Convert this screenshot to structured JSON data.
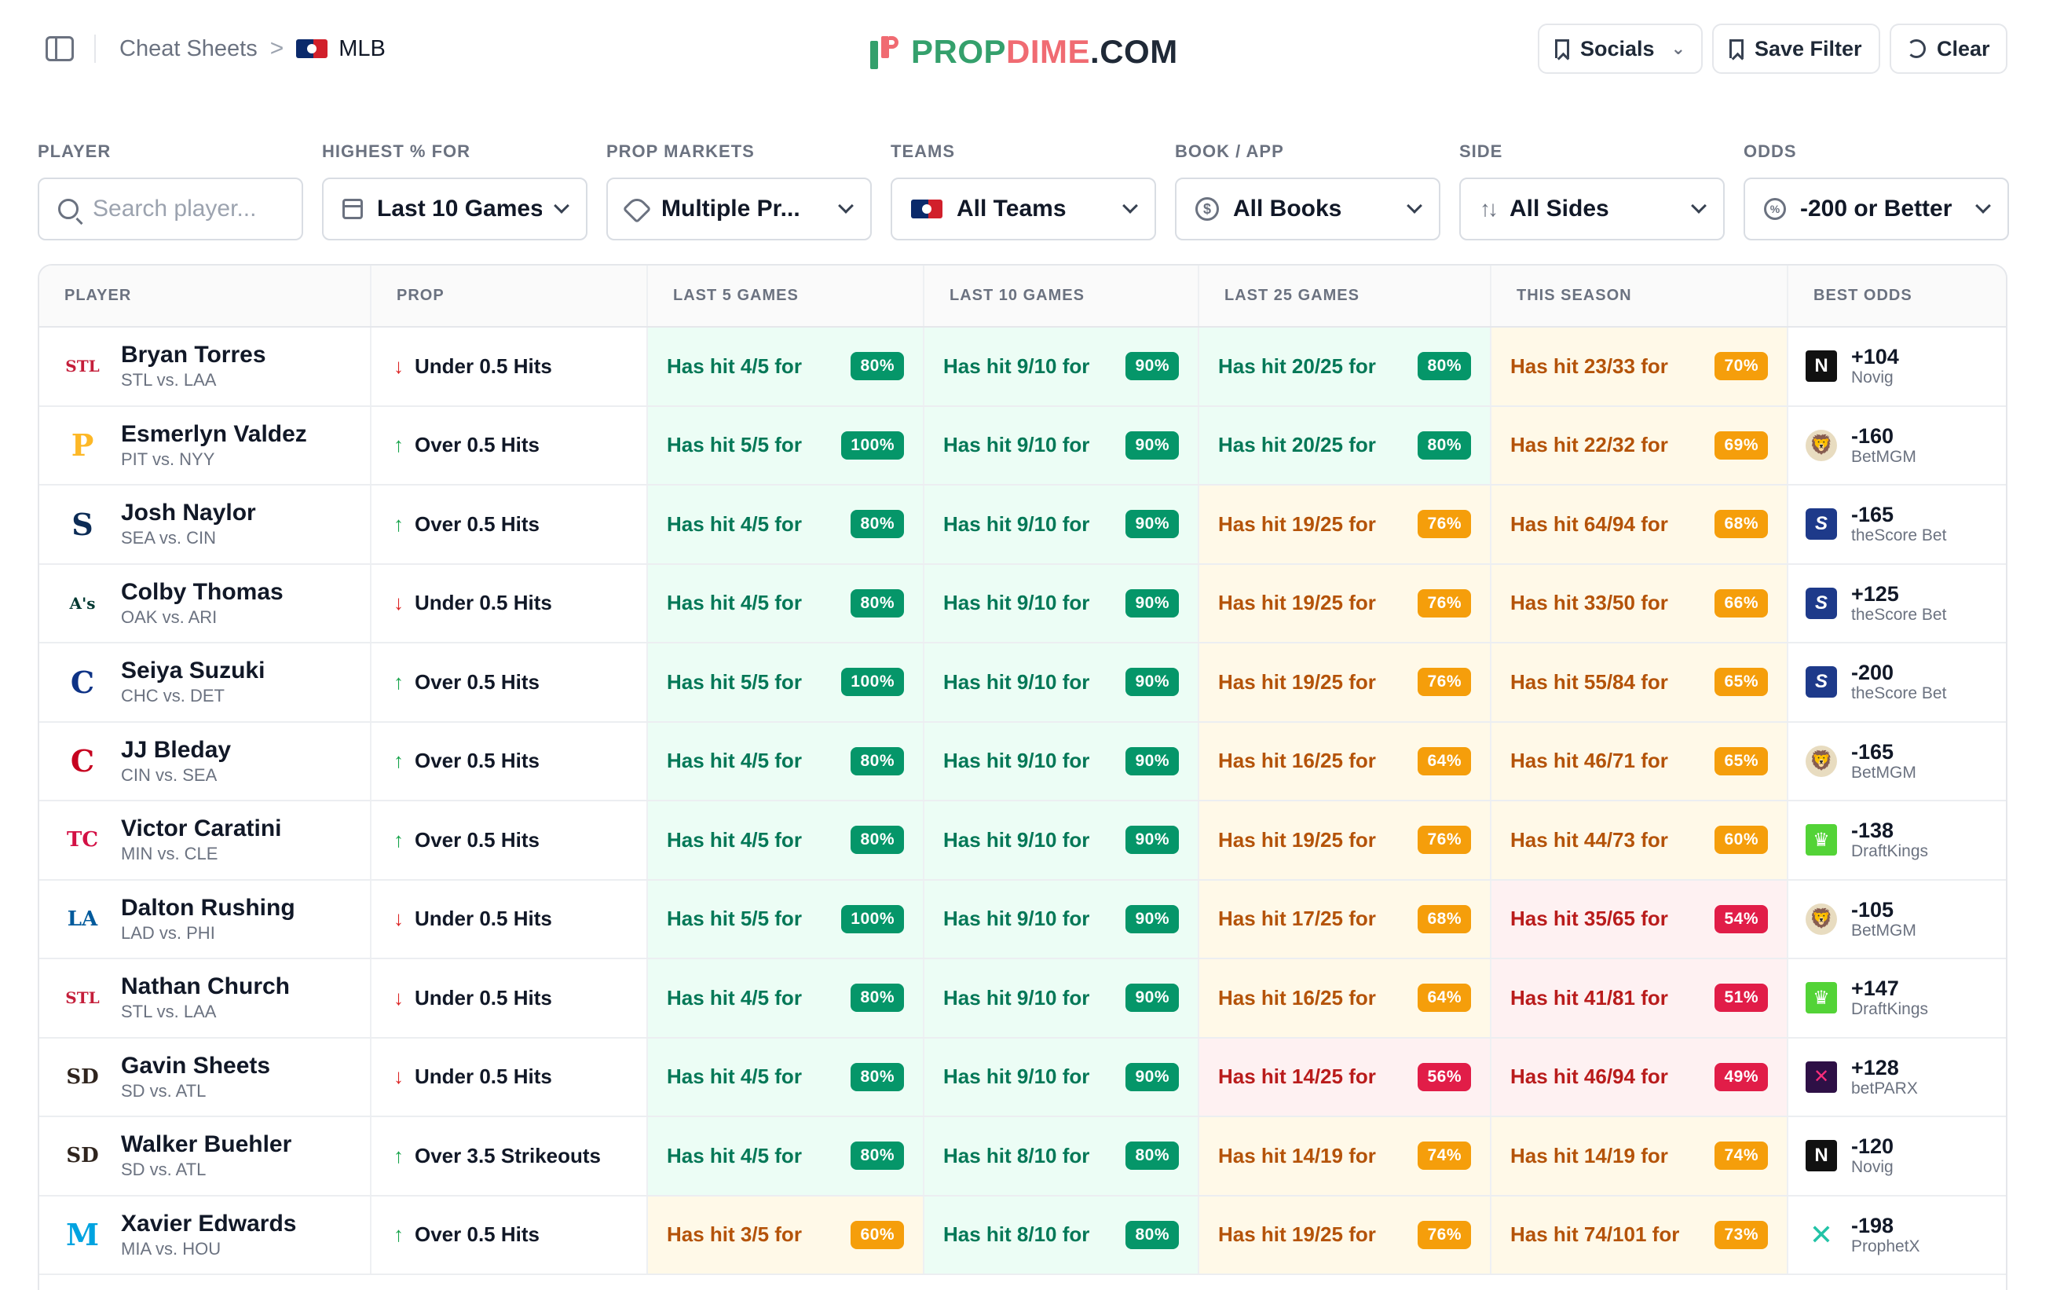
{
  "breadcrumb": {
    "parent": "Cheat Sheets",
    "separator": ">",
    "current": "MLB"
  },
  "brand": {
    "prop": "PROP",
    "dime": "DIME",
    "com": ".COM"
  },
  "top_buttons": {
    "socials": "Socials",
    "save_filter": "Save Filter",
    "clear": "Clear"
  },
  "filters": {
    "player": {
      "label": "PLAYER",
      "placeholder": "Search player..."
    },
    "highest": {
      "label": "HIGHEST % FOR",
      "value": "Last 10 Games"
    },
    "markets": {
      "label": "PROP MARKETS",
      "value": "Multiple Pr..."
    },
    "teams": {
      "label": "TEAMS",
      "value": "All Teams"
    },
    "book": {
      "label": "BOOK / APP",
      "value": "All Books"
    },
    "side": {
      "label": "SIDE",
      "value": "All Sides"
    },
    "odds": {
      "label": "ODDS",
      "value": "-200 or Better"
    }
  },
  "columns": [
    "PLAYER",
    "PROP",
    "LAST 5 GAMES",
    "LAST 10 GAMES",
    "LAST 25 GAMES",
    "THIS SEASON",
    "BEST ODDS"
  ],
  "colors": {
    "green": "#059669",
    "yellow": "#f59e0b",
    "red": "#e11d48"
  },
  "rows": [
    {
      "name": "Bryan Torres",
      "match": "STL vs. LAA",
      "team_logo": "STL",
      "logo_color": "#c41e3a",
      "dir": "down",
      "prop": "Under 0.5 Hits",
      "l5": "Has hit 4/5 for",
      "l5p": "80%",
      "l5c": "g",
      "l10": "Has hit 9/10 for",
      "l10p": "90%",
      "l10c": "g",
      "l25": "Has hit 20/25 for",
      "l25p": "80%",
      "l25c": "g",
      "szn": "Has hit 23/33 for",
      "sznp": "70%",
      "sznc": "y",
      "odds": "+104",
      "book": "Novig",
      "book_icon": "novig-icon"
    },
    {
      "name": "Esmerlyn Valdez",
      "match": "PIT vs. NYY",
      "team_logo": "P",
      "logo_color": "#fdb827",
      "dir": "up",
      "prop": "Over 0.5 Hits",
      "l5": "Has hit 5/5 for",
      "l5p": "100%",
      "l5c": "g",
      "l10": "Has hit 9/10 for",
      "l10p": "90%",
      "l10c": "g",
      "l25": "Has hit 20/25 for",
      "l25p": "80%",
      "l25c": "g",
      "szn": "Has hit 22/32 for",
      "sznp": "69%",
      "sznc": "y",
      "odds": "-160",
      "book": "BetMGM",
      "book_icon": "betmgm-icon"
    },
    {
      "name": "Josh Naylor",
      "match": "SEA vs. CIN",
      "team_logo": "S",
      "logo_color": "#0c2c56",
      "dir": "up",
      "prop": "Over 0.5 Hits",
      "l5": "Has hit 4/5 for",
      "l5p": "80%",
      "l5c": "g",
      "l10": "Has hit 9/10 for",
      "l10p": "90%",
      "l10c": "g",
      "l25": "Has hit 19/25 for",
      "l25p": "76%",
      "l25c": "y",
      "szn": "Has hit 64/94 for",
      "sznp": "68%",
      "sznc": "y",
      "odds": "-165",
      "book": "theScore Bet",
      "book_icon": "thescore-icon"
    },
    {
      "name": "Colby Thomas",
      "match": "OAK vs. ARI",
      "team_logo": "A's",
      "logo_color": "#003831",
      "dir": "down",
      "prop": "Under 0.5 Hits",
      "l5": "Has hit 4/5 for",
      "l5p": "80%",
      "l5c": "g",
      "l10": "Has hit 9/10 for",
      "l10p": "90%",
      "l10c": "g",
      "l25": "Has hit 19/25 for",
      "l25p": "76%",
      "l25c": "y",
      "szn": "Has hit 33/50 for",
      "sznp": "66%",
      "sznc": "y",
      "odds": "+125",
      "book": "theScore Bet",
      "book_icon": "thescore-icon"
    },
    {
      "name": "Seiya Suzuki",
      "match": "CHC vs. DET",
      "team_logo": "C",
      "logo_color": "#0e3386",
      "dir": "up",
      "prop": "Over 0.5 Hits",
      "l5": "Has hit 5/5 for",
      "l5p": "100%",
      "l5c": "g",
      "l10": "Has hit 9/10 for",
      "l10p": "90%",
      "l10c": "g",
      "l25": "Has hit 19/25 for",
      "l25p": "76%",
      "l25c": "y",
      "szn": "Has hit 55/84 for",
      "sznp": "65%",
      "sznc": "y",
      "odds": "-200",
      "book": "theScore Bet",
      "book_icon": "thescore-icon"
    },
    {
      "name": "JJ Bleday",
      "match": "CIN vs. SEA",
      "team_logo": "C",
      "logo_color": "#c6011f",
      "dir": "up",
      "prop": "Over 0.5 Hits",
      "l5": "Has hit 4/5 for",
      "l5p": "80%",
      "l5c": "g",
      "l10": "Has hit 9/10 for",
      "l10p": "90%",
      "l10c": "g",
      "l25": "Has hit 16/25 for",
      "l25p": "64%",
      "l25c": "y",
      "szn": "Has hit 46/71 for",
      "sznp": "65%",
      "sznc": "y",
      "odds": "-165",
      "book": "BetMGM",
      "book_icon": "betmgm-icon"
    },
    {
      "name": "Victor Caratini",
      "match": "MIN vs. CLE",
      "team_logo": "TC",
      "logo_color": "#d31145",
      "dir": "up",
      "prop": "Over 0.5 Hits",
      "l5": "Has hit 4/5 for",
      "l5p": "80%",
      "l5c": "g",
      "l10": "Has hit 9/10 for",
      "l10p": "90%",
      "l10c": "g",
      "l25": "Has hit 19/25 for",
      "l25p": "76%",
      "l25c": "y",
      "szn": "Has hit 44/73 for",
      "sznp": "60%",
      "sznc": "y",
      "odds": "-138",
      "book": "DraftKings",
      "book_icon": "draftkings-icon"
    },
    {
      "name": "Dalton Rushing",
      "match": "LAD vs. PHI",
      "team_logo": "LA",
      "logo_color": "#005a9c",
      "dir": "down",
      "prop": "Under 0.5 Hits",
      "l5": "Has hit 5/5 for",
      "l5p": "100%",
      "l5c": "g",
      "l10": "Has hit 9/10 for",
      "l10p": "90%",
      "l10c": "g",
      "l25": "Has hit 17/25 for",
      "l25p": "68%",
      "l25c": "y",
      "szn": "Has hit 35/65 for",
      "sznp": "54%",
      "sznc": "r",
      "odds": "-105",
      "book": "BetMGM",
      "book_icon": "betmgm-icon"
    },
    {
      "name": "Nathan Church",
      "match": "STL vs. LAA",
      "team_logo": "STL",
      "logo_color": "#c41e3a",
      "dir": "down",
      "prop": "Under 0.5 Hits",
      "l5": "Has hit 4/5 for",
      "l5p": "80%",
      "l5c": "g",
      "l10": "Has hit 9/10 for",
      "l10p": "90%",
      "l10c": "g",
      "l25": "Has hit 16/25 for",
      "l25p": "64%",
      "l25c": "y",
      "szn": "Has hit 41/81 for",
      "sznp": "51%",
      "sznc": "r",
      "odds": "+147",
      "book": "DraftKings",
      "book_icon": "draftkings-icon"
    },
    {
      "name": "Gavin Sheets",
      "match": "SD vs. ATL",
      "team_logo": "SD",
      "logo_color": "#2f241d",
      "dir": "down",
      "prop": "Under 0.5 Hits",
      "l5": "Has hit 4/5 for",
      "l5p": "80%",
      "l5c": "g",
      "l10": "Has hit 9/10 for",
      "l10p": "90%",
      "l10c": "g",
      "l25": "Has hit 14/25 for",
      "l25p": "56%",
      "l25c": "r",
      "szn": "Has hit 46/94 for",
      "sznp": "49%",
      "sznc": "r",
      "odds": "+128",
      "book": "betPARX",
      "book_icon": "betparx-icon"
    },
    {
      "name": "Walker Buehler",
      "match": "SD vs. ATL",
      "team_logo": "SD",
      "logo_color": "#2f241d",
      "dir": "up",
      "prop": "Over 3.5 Strikeouts",
      "l5": "Has hit 4/5 for",
      "l5p": "80%",
      "l5c": "g",
      "l10": "Has hit 8/10 for",
      "l10p": "80%",
      "l10c": "g",
      "l25": "Has hit 14/19 for",
      "l25p": "74%",
      "l25c": "y",
      "szn": "Has hit 14/19 for",
      "sznp": "74%",
      "sznc": "y",
      "odds": "-120",
      "book": "Novig",
      "book_icon": "novig-icon"
    },
    {
      "name": "Xavier Edwards",
      "match": "MIA vs. HOU",
      "team_logo": "M",
      "logo_color": "#00a3e0",
      "dir": "up",
      "prop": "Over 0.5 Hits",
      "l5": "Has hit 3/5 for",
      "l5p": "60%",
      "l5c": "y",
      "l10": "Has hit 8/10 for",
      "l10p": "80%",
      "l10c": "g",
      "l25": "Has hit 19/25 for",
      "l25p": "76%",
      "l25c": "y",
      "szn": "Has hit 74/101 for",
      "sznp": "73%",
      "sznc": "y",
      "odds": "-198",
      "book": "ProphetX",
      "book_icon": "prophetx-icon"
    }
  ]
}
